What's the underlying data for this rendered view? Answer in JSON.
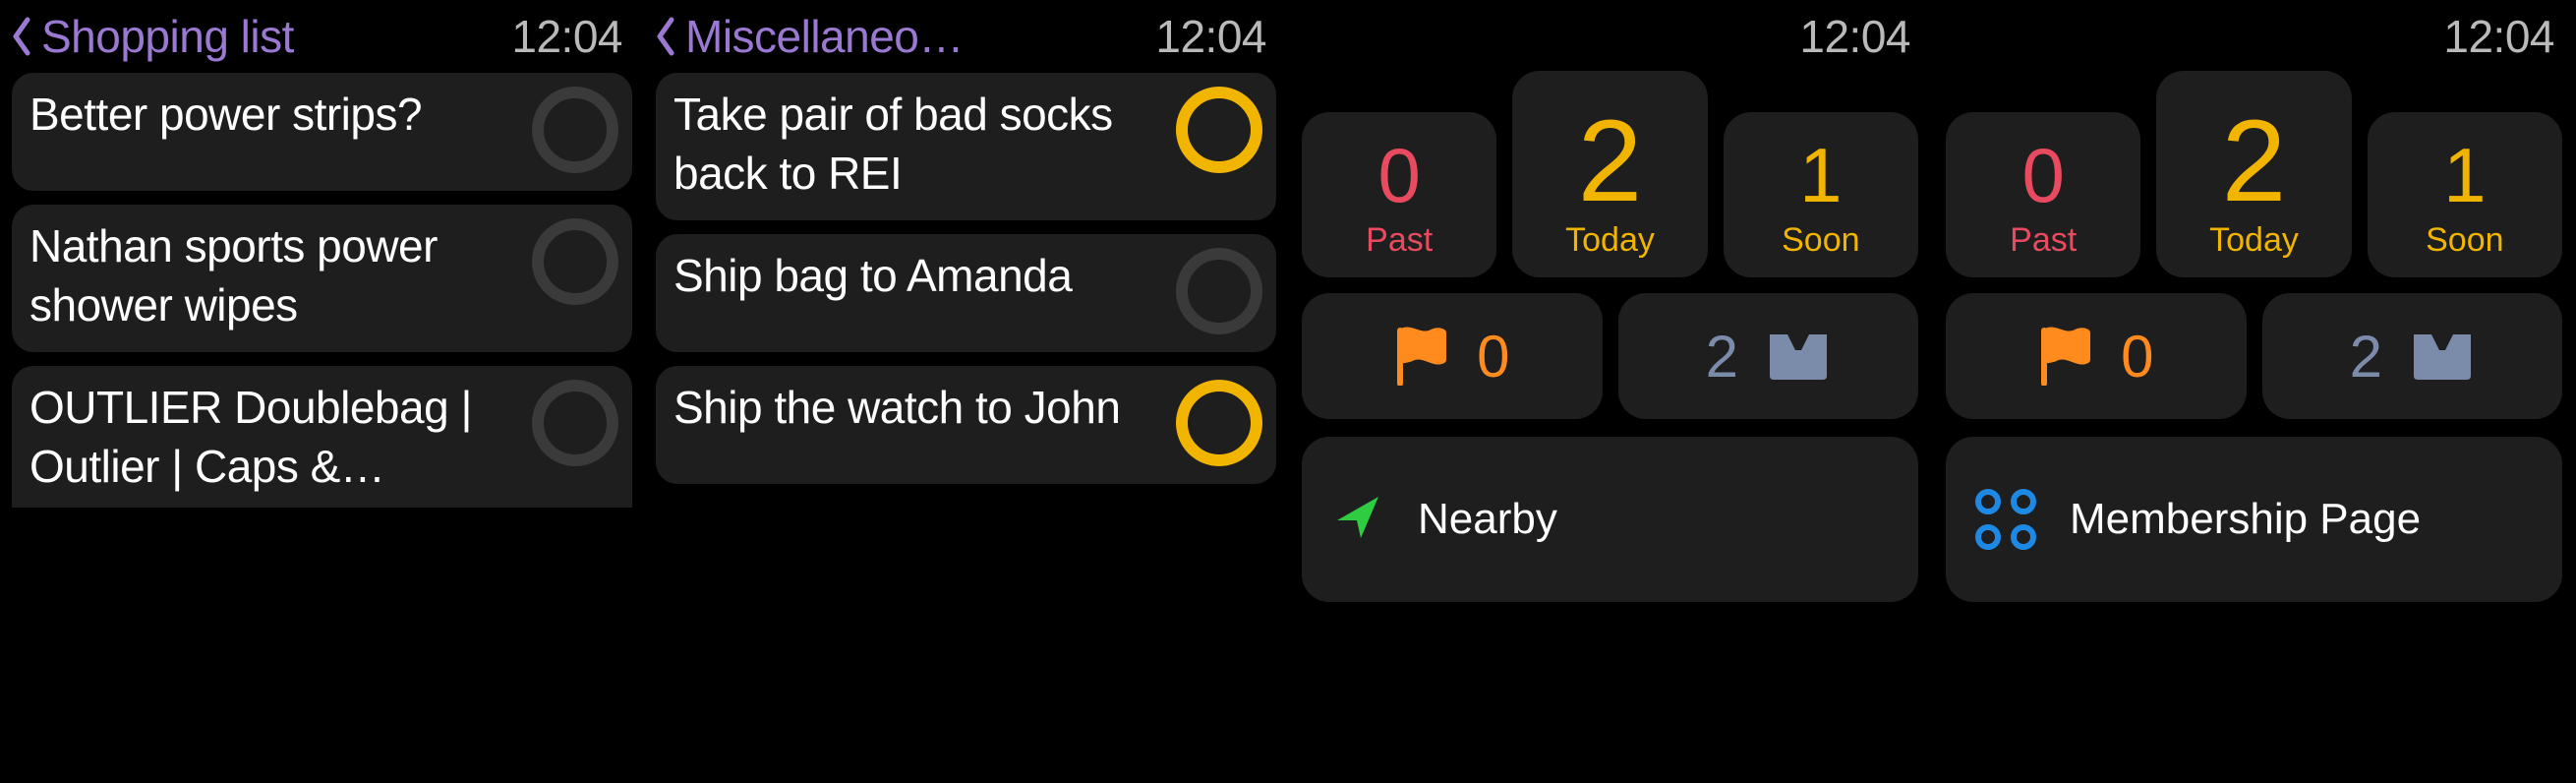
{
  "time": "12:04",
  "screens": {
    "shopping": {
      "title": "Shopping list",
      "items": [
        {
          "text": "Better power strips?",
          "done": false
        },
        {
          "text": "Nathan sports power shower wipes",
          "done": false
        },
        {
          "text": "OUTLIER Doublebag | Outlier | Caps &…",
          "done": false
        }
      ]
    },
    "misc": {
      "title": "Miscellaneo…",
      "items": [
        {
          "text": "Take pair of bad socks back to REI",
          "done": true
        },
        {
          "text": "Ship bag to Amanda",
          "done": false
        },
        {
          "text": "Ship the watch to John",
          "done": true
        }
      ]
    },
    "dash": {
      "stats": {
        "past": {
          "value": "0",
          "label": "Past"
        },
        "today": {
          "value": "2",
          "label": "Today"
        },
        "soon": {
          "value": "1",
          "label": "Soon"
        }
      },
      "flagged": "0",
      "inbox": "2",
      "nearby_label": "Nearby",
      "membership_label": "Membership Page"
    }
  },
  "icons": {
    "back": "chevron-left-icon",
    "flag": "flag-icon",
    "inbox": "inbox-icon",
    "location": "location-arrow-icon",
    "dots": "four-dots-icon"
  }
}
